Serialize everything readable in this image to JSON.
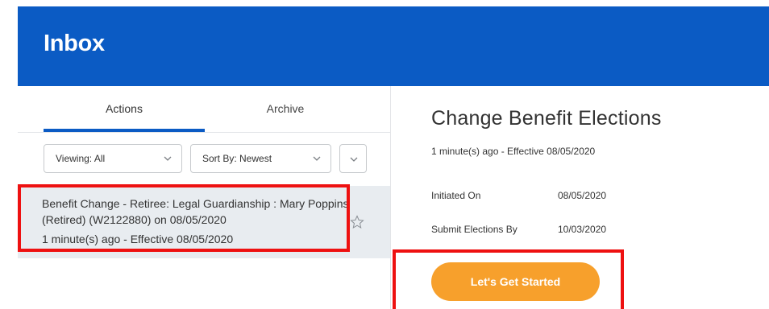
{
  "header": {
    "title": "Inbox"
  },
  "tabs": [
    {
      "label": "Actions",
      "active": true
    },
    {
      "label": "Archive",
      "active": false
    }
  ],
  "filters": {
    "viewing": "Viewing: All",
    "sort": "Sort By: Newest"
  },
  "inbox_items": [
    {
      "title": "Benefit Change - Retiree: Legal Guardianship : Mary Poppins (Retired) (W2122880) on 08/05/2020",
      "meta": "1 minute(s) ago - Effective 08/05/2020",
      "starred": false
    }
  ],
  "detail": {
    "title": "Change Benefit Elections",
    "meta": "1 minute(s) ago - Effective 08/05/2020",
    "fields": [
      {
        "label": "Initiated On",
        "value": "08/05/2020"
      },
      {
        "label": "Submit Elections By",
        "value": "10/03/2020"
      }
    ],
    "cta_label": "Let's Get Started"
  },
  "icons": {
    "chevron": "chevron-down-icon",
    "star": "star-icon"
  },
  "colors": {
    "header_bg": "#0b5bc4",
    "tab_underline": "#0b5bc4",
    "cta_bg": "#f7a02c",
    "highlight": "#ee1111",
    "selected_row_bg": "#e8ecf0"
  }
}
